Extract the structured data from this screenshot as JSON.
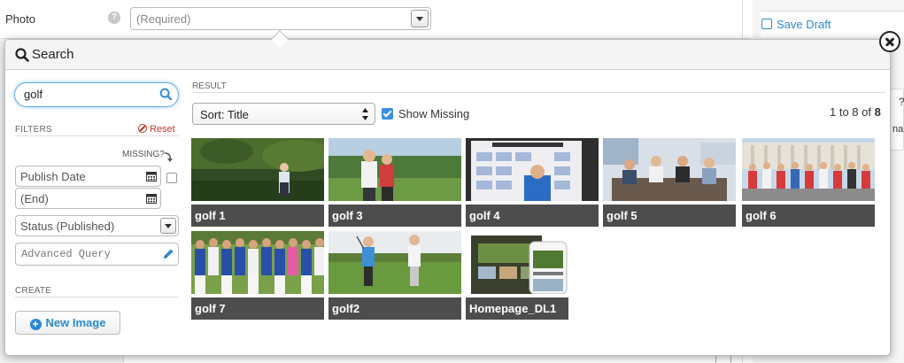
{
  "background": {
    "field_label": "Photo",
    "help_icon": "question-circle-icon",
    "help_text": "?",
    "select_placeholder": "(Required)",
    "save_draft": "Save Draft",
    "right_text": "nal",
    "right_q": "?"
  },
  "modal": {
    "title": "Search",
    "search_value": "golf",
    "filters_label": "FILTERS",
    "reset_label": "Reset",
    "missing_label": "MISSING?",
    "publish_date": "Publish Date",
    "end_date": "(End)",
    "status": "Status (Published)",
    "advanced_query": "Advanced Query",
    "create_label": "CREATE",
    "new_image": "New Image",
    "new_image_icon": "+",
    "result_label": "RESULT",
    "sort_label": "Sort: Title",
    "show_missing": "Show Missing",
    "count_prefix": "1 to 8 of ",
    "count_total": "8",
    "accent_color": "#2a8ad4",
    "reset_color": "#c0392b"
  },
  "results": [
    {
      "caption": "golf 1"
    },
    {
      "caption": "golf 3"
    },
    {
      "caption": "golf 4"
    },
    {
      "caption": "golf 5"
    },
    {
      "caption": "golf 6"
    },
    {
      "caption": "golf 7"
    },
    {
      "caption": "golf2"
    },
    {
      "caption": "Homepage_DL1"
    }
  ]
}
